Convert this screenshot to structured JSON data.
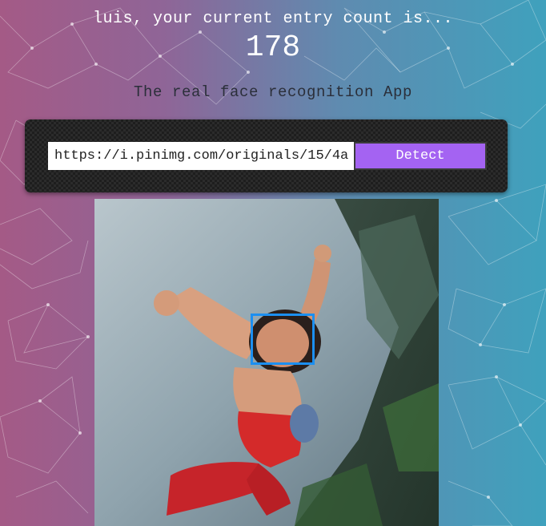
{
  "header": {
    "entry_text": "luis, your current entry count is...",
    "entry_count": "178"
  },
  "subtitle": "The real face recognition App",
  "form": {
    "url_value": "https://i.pinimg.com/originals/15/4a",
    "detect_label": "Detect"
  },
  "colors": {
    "gradient_left": "#a45a86",
    "gradient_right": "#3fa1bd",
    "button": "#a463f2",
    "face_box": "#1c8ff0"
  }
}
